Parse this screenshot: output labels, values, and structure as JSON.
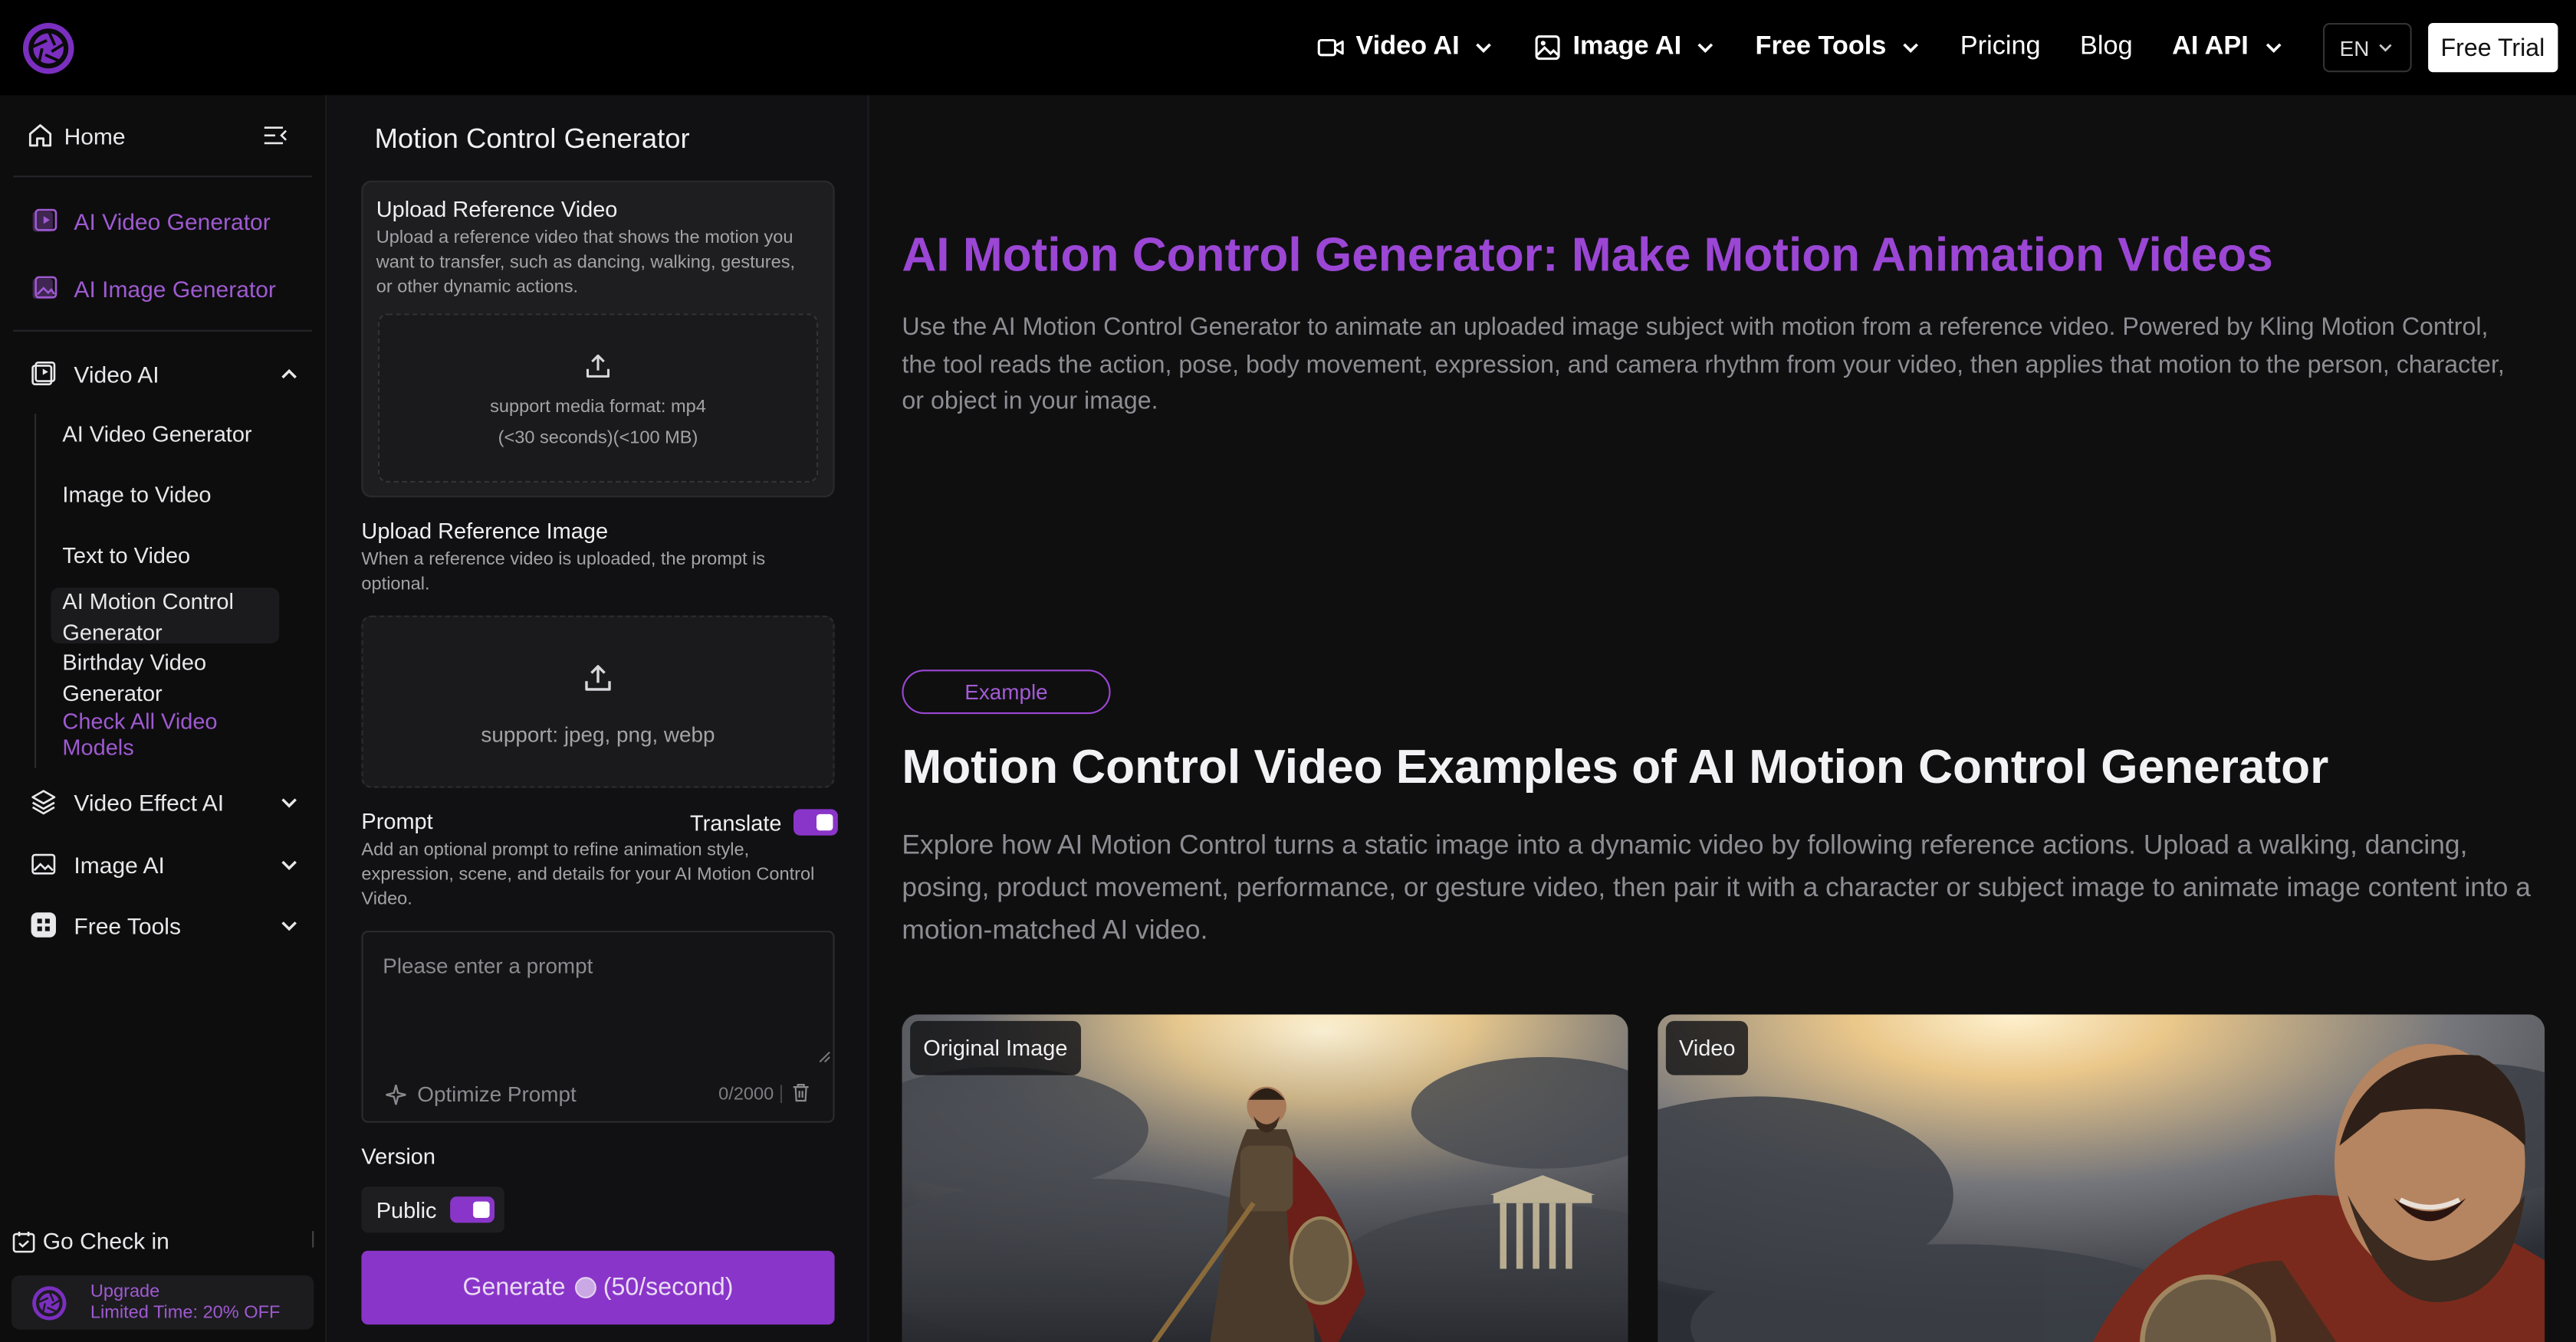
{
  "nav": {
    "items": [
      {
        "label": "Video AI",
        "icon": "video-camera-icon",
        "dropdown": true,
        "bold": true
      },
      {
        "label": "Image AI",
        "icon": "image-icon",
        "dropdown": true,
        "bold": true
      },
      {
        "label": "Free Tools",
        "dropdown": true,
        "bold": true
      },
      {
        "label": "Pricing",
        "dropdown": false,
        "bold": false
      },
      {
        "label": "Blog",
        "dropdown": false,
        "bold": false
      },
      {
        "label": "AI API",
        "dropdown": true,
        "bold": true
      }
    ],
    "language": "EN",
    "cta": "Free Trial"
  },
  "sidebar": {
    "home": "Home",
    "top_links": [
      "AI Video Generator",
      "AI Image Generator"
    ],
    "video_ai": {
      "label": "Video AI",
      "children": [
        "AI Video Generator",
        "Image to Video",
        "Text to Video",
        "AI Motion Control Generator",
        "Birthday Video Generator"
      ],
      "more": "Check All Video Models"
    },
    "sections": [
      "Video Effect AI",
      "Image AI",
      "Free Tools"
    ],
    "check_in": "Go Check in",
    "upgrade": {
      "line1": "Upgrade",
      "line2": "Limited Time: 20% OFF"
    }
  },
  "panel": {
    "title": "Motion Control Generator",
    "ref_video": {
      "title": "Upload Reference Video",
      "desc": "Upload a reference video that shows the motion you want to transfer, such as dancing, walking, gestures, or other dynamic actions.",
      "format": "support media format: mp4",
      "limits": "(<30 seconds)(<100 MB)"
    },
    "ref_image": {
      "title": "Upload Reference Image",
      "desc": "When a reference video is uploaded, the prompt is optional.",
      "formats": "support: jpeg, png, webp"
    },
    "prompt": {
      "label": "Prompt",
      "translate_label": "Translate",
      "translate_on": true,
      "desc": "Add an optional prompt to refine animation style, expression, scene, and details for your AI Motion Control Video.",
      "placeholder": "Please enter a prompt",
      "optimize": "Optimize Prompt",
      "counter": "0/2000"
    },
    "version": {
      "label": "Version",
      "public_label": "Public",
      "public_on": true
    },
    "generate": {
      "label": "Generate",
      "cost": "(50/second)"
    }
  },
  "main": {
    "title": "AI Motion Control Generator: Make Motion Animation Videos",
    "intro": "Use the AI Motion Control Generator to animate an uploaded image subject with motion from a reference video. Powered by Kling Motion Control, the tool reads the action, pose, body movement, expression, and camera rhythm from your video, then applies that motion to the person, character, or object in your image.",
    "example_badge": "Example",
    "section_title": "Motion Control Video Examples of AI Motion Control Generator",
    "section_desc": "Explore how AI Motion Control turns a static image into a dynamic video by following reference actions. Upload a walking, dancing, posing, product movement, performance, or gesture video, then pair it with a character or subject image to animate image content into a motion-matched AI video.",
    "media": [
      {
        "tag": "Original Image"
      },
      {
        "tag": "Video"
      }
    ]
  },
  "colors": {
    "accent": "#8a35c9",
    "heading_purple": "#9b46d4",
    "bg": "#0f0f10"
  }
}
